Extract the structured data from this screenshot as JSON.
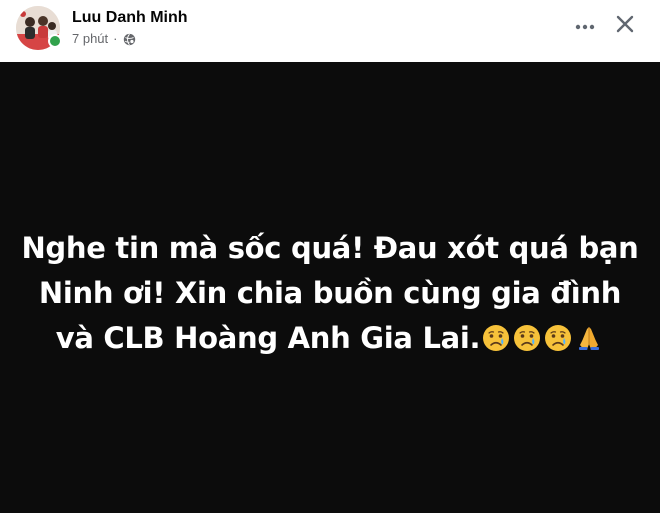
{
  "post": {
    "author": "Luu Danh Minh",
    "time": "7 phút",
    "separator": "·",
    "privacy_icon": "globe-icon",
    "online_status_color": "#31a24c",
    "background_color": "#0c0c0c",
    "text_color": "#ffffff",
    "lines": [
      "Nghe tin mà sốc quá! Đau xót quá bạn",
      "Ninh ơi! Xin chia buồn cùng gia đình",
      "và CLB Hoàng Anh Gia Lai."
    ],
    "emojis": [
      "crying-face-icon",
      "crying-face-icon",
      "crying-face-icon",
      "folded-hands-icon"
    ]
  },
  "header": {
    "more_icon": "ellipsis-icon",
    "close_icon": "close-icon"
  }
}
